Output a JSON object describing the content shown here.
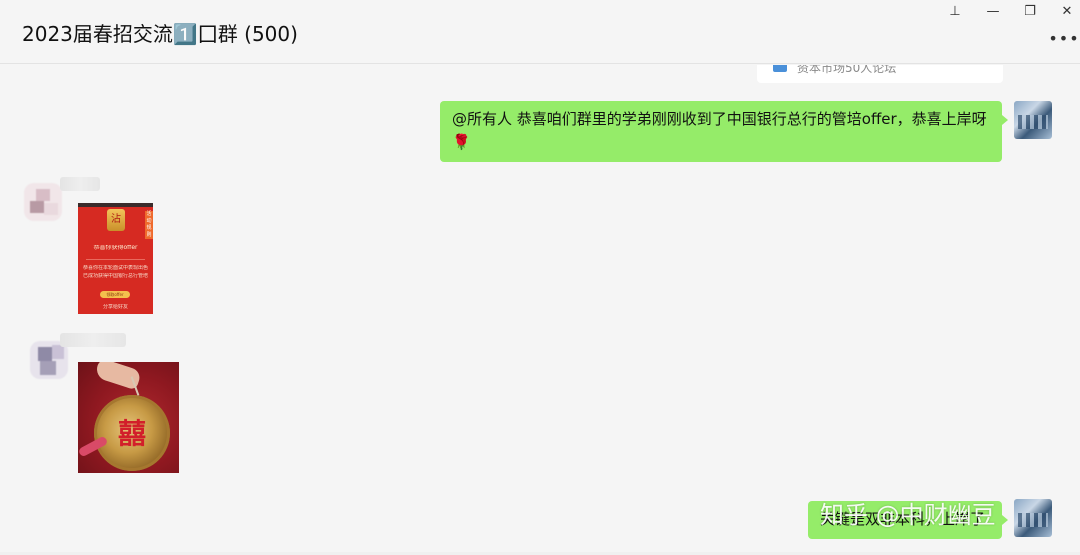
{
  "window": {
    "title": "2023届春招交流1️⃣囗群 (500)",
    "controls": {
      "pin": "⊥",
      "minimize": "—",
      "restore": "❐",
      "close": "✕"
    },
    "more_label": "•••"
  },
  "chat": {
    "link_card_preview": "资本市场50人论坛",
    "messages": [
      {
        "sender": "me",
        "type": "text",
        "text": "@所有人 恭喜咱们群里的学弟刚刚收到了中国银行总行的管培offer，恭喜上岸呀🌹"
      },
      {
        "sender": "member",
        "type": "image",
        "image": {
          "can_label": "沾",
          "corner_label": "活动规则",
          "headline": "恭喜你获得offer",
          "line1": "恭喜你在本轮面试中表现出色",
          "line2": "已成功获得中国银行总行管培",
          "button": "领取offer",
          "footer": "分享给好友"
        }
      },
      {
        "sender": "member",
        "type": "image",
        "image": {
          "glyph": "囍"
        }
      },
      {
        "sender": "me",
        "type": "text",
        "text": "关键是双非本科，上岸了"
      }
    ]
  },
  "watermark": "知乎 @中财幽豆"
}
